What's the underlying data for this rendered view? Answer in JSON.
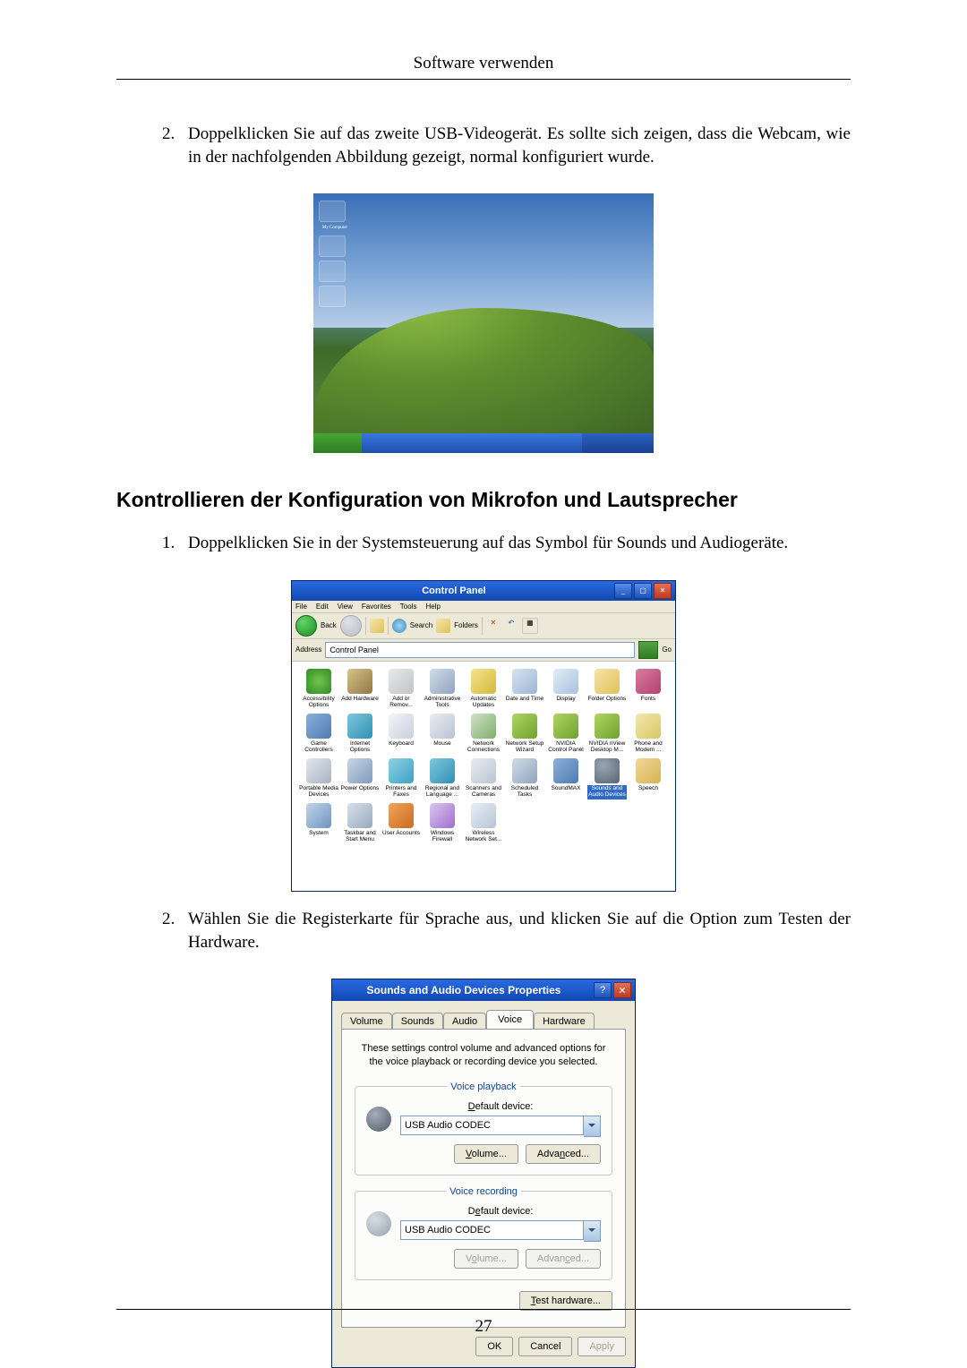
{
  "doc": {
    "header": "Software verwenden",
    "page_number": "27",
    "step_top_2": "Doppelklicken Sie auf das zweite USB-Videogerät. Es sollte sich zeigen, dass die Webcam, wie in der nachfolgenden Abbildung gezeigt, normal konfiguriert wurde.",
    "heading2": "Kontrollieren der Konfiguration von Mikrofon und Lautsprecher",
    "step_b_1": "Doppelklicken Sie in der Systemsteuerung auf das Symbol für Sounds und Audiogeräte.",
    "step_b_2": "Wählen Sie die Registerkarte für Sprache aus, und klicken Sie auf die Option zum Testen der Hardware."
  },
  "desktop": {
    "my_computer": "My Computer"
  },
  "cp": {
    "title": "Control Panel",
    "menu": {
      "file": "File",
      "edit": "Edit",
      "view": "View",
      "favorites": "Favorites",
      "tools": "Tools",
      "help": "Help"
    },
    "toolbar": {
      "back": "Back",
      "search": "Search",
      "folders": "Folders"
    },
    "address_label": "Address",
    "address_value": "Control Panel",
    "go": "Go",
    "items": [
      "Accessibility Options",
      "Add Hardware",
      "Add or Remov...",
      "Administrative Tools",
      "Automatic Updates",
      "Date and Time",
      "Display",
      "Folder Options",
      "Fonts",
      "Game Controllers",
      "Internet Options",
      "Keyboard",
      "Mouse",
      "Network Connections",
      "Network Setup Wizard",
      "NVIDIA Control Panel",
      "NVIDIA nView Desktop M...",
      "Phone and Modem ...",
      "Portable Media Devices",
      "Power Options",
      "Printers and Faxes",
      "Regional and Language ...",
      "Scanners and Cameras",
      "Scheduled Tasks",
      "SoundMAX",
      "Sounds and Audio Devices",
      "Speech",
      "System",
      "Taskbar and Start Menu",
      "User Accounts",
      "Windows Firewall",
      "Wireless Network Set..."
    ],
    "selected_index": 25
  },
  "dlg": {
    "title": "Sounds and Audio Devices Properties",
    "tabs": {
      "volume": "Volume",
      "sounds": "Sounds",
      "audio": "Audio",
      "voice": "Voice",
      "hardware": "Hardware"
    },
    "desc": "These settings control volume and advanced options for the voice playback or recording device you selected.",
    "playback": {
      "legend": "Voice playback",
      "label": "Default device:",
      "device": "USB Audio CODEC",
      "volume_btn": "Volume...",
      "advanced_btn": "Advanced..."
    },
    "recording": {
      "legend": "Voice recording",
      "label": "Default device:",
      "device": "USB Audio CODEC",
      "volume_btn": "Volume...",
      "advanced_btn": "Advanced..."
    },
    "test_hw_btn": "Test hardware...",
    "ok": "OK",
    "cancel": "Cancel",
    "apply": "Apply"
  }
}
